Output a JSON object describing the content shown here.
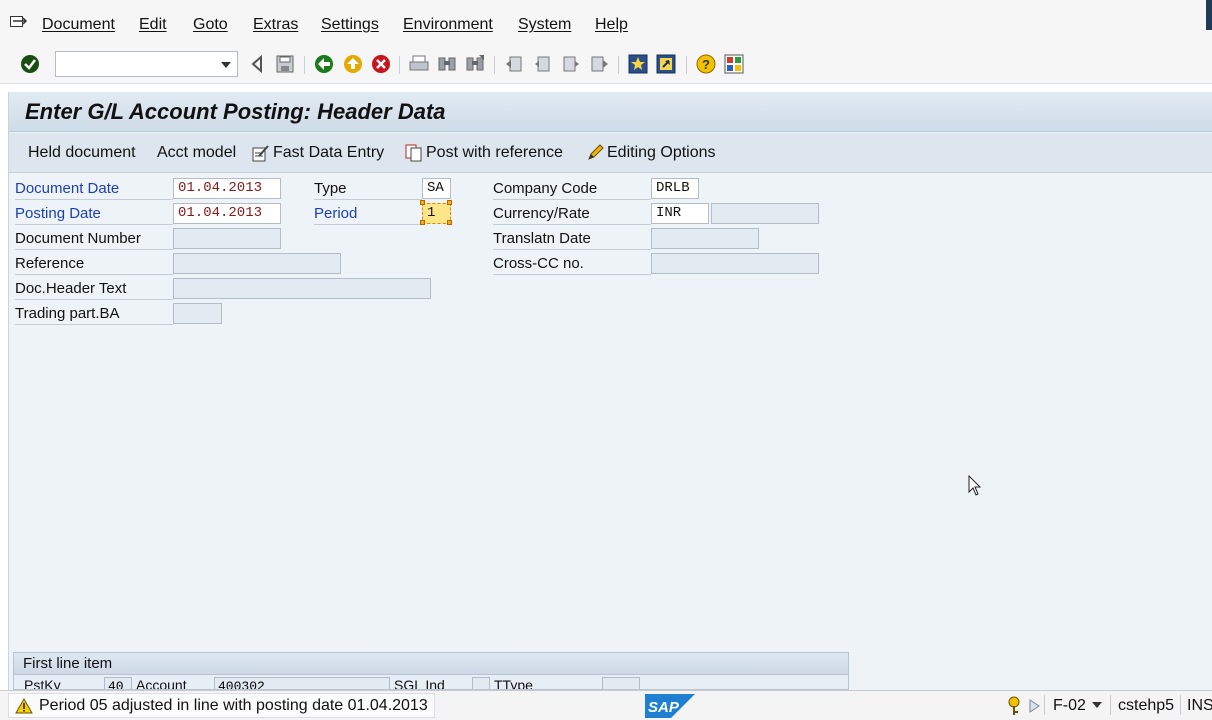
{
  "menu": {
    "items": [
      {
        "label": "Document"
      },
      {
        "label": "Edit"
      },
      {
        "label": "Goto"
      },
      {
        "label": "Extras"
      },
      {
        "label": "Settings"
      },
      {
        "label": "Environment"
      },
      {
        "label": "System"
      },
      {
        "label": "Help"
      }
    ]
  },
  "toolbar": {
    "command_field_value": "",
    "icons": [
      "enter-check-icon",
      "back-triangle-icon",
      "save-icon",
      "back-green-icon",
      "exit-yellow-icon",
      "cancel-red-icon",
      "print-icon",
      "find-icon",
      "find-next-icon",
      "first-page-icon",
      "previous-page-icon",
      "next-page-icon",
      "last-page-icon",
      "create-session-icon",
      "shortcut-icon",
      "help-icon",
      "customize-layout-icon"
    ]
  },
  "screen": {
    "title": "Enter G/L Account Posting: Header Data",
    "app_buttons": {
      "held_document": "Held document",
      "acct_model": "Acct model",
      "fast_data_entry": "Fast Data Entry",
      "post_with_reference": "Post with reference",
      "editing_options": "Editing Options"
    }
  },
  "form": {
    "document_date": {
      "label": "Document Date",
      "value": "01.04.2013"
    },
    "posting_date": {
      "label": "Posting Date",
      "value": "01.04.2013"
    },
    "document_number": {
      "label": "Document Number",
      "value": ""
    },
    "reference": {
      "label": "Reference",
      "value": ""
    },
    "doc_header_text": {
      "label": "Doc.Header Text",
      "value": ""
    },
    "trading_part_ba": {
      "label": "Trading part.BA",
      "value": ""
    },
    "type": {
      "label": "Type",
      "value": "SA"
    },
    "period": {
      "label": "Period",
      "value": "1"
    },
    "company_code": {
      "label": "Company Code",
      "value": "DRLB"
    },
    "currency_rate": {
      "label": "Currency/Rate",
      "currency": "INR",
      "rate": ""
    },
    "translatn_date": {
      "label": "Translatn Date",
      "value": ""
    },
    "cross_cc_no": {
      "label": "Cross-CC no.",
      "value": ""
    }
  },
  "first_line_item": {
    "title": "First line item",
    "pstky_label": "PstKy",
    "pstky_value": "40",
    "account_label": "Account",
    "account_value": "400302",
    "sgl_ind_label": "SGL Ind",
    "ttype_label": "TType"
  },
  "status": {
    "message": "Period 05 adjusted in line with posting date 01.04.2013",
    "transaction": "F-02",
    "server": "cstehp5",
    "mode": "INS"
  },
  "colors": {
    "required_label": "#1d3fb1",
    "date_value": "#8a1a1a",
    "title_bar": "#cfdbe7",
    "focus_field": "#ffe58a"
  }
}
